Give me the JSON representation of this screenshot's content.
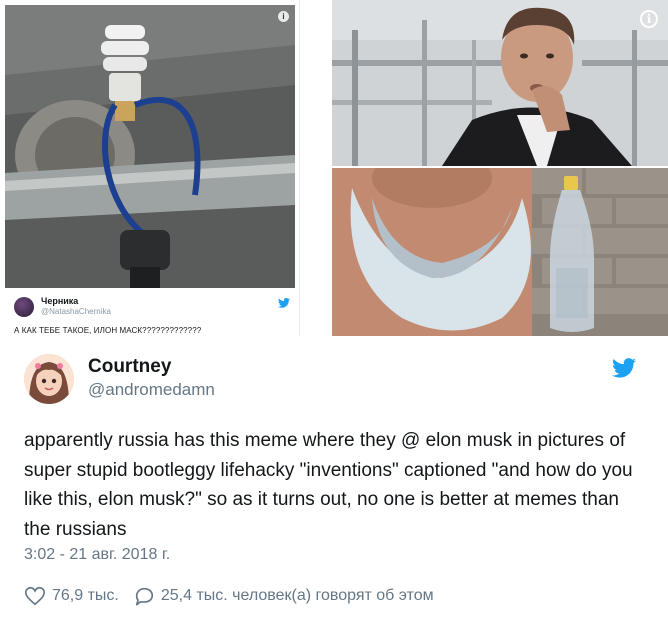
{
  "embed": {
    "name": "Черника",
    "handle": "@NatashaChernika",
    "text": "А КАК ТЕБЕ ТАКОЕ, ИЛОН МАСК?????????????",
    "info_icon": "info-icon",
    "bird_icon": "twitter-bird-icon"
  },
  "photos": {
    "info_icon": "info-circle-icon"
  },
  "tweet": {
    "name": "Courtney",
    "handle": "@andromedamn",
    "text": "apparently russia has this meme where they @ elon musk in pictures of super stupid bootleggy lifehacky \"inventions\" captioned \"and how do you like this, elon musk?\" so as it turns out, no one is better at memes than the russians",
    "timestamp": "3:02 - 21 авг. 2018 г.",
    "likes": "76,9 тыс.",
    "replies": "25,4 тыс. человек(а) говорят об этом",
    "accent_color": "#1da1f2",
    "muted_color": "#657786"
  }
}
